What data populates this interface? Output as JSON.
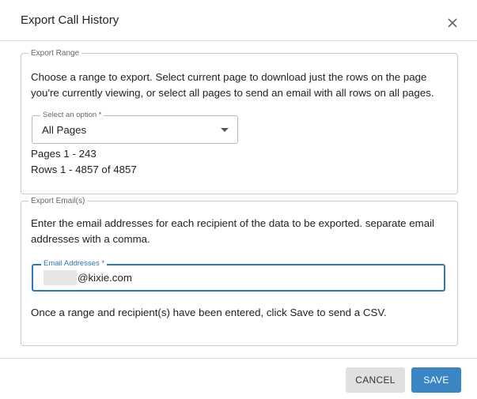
{
  "dialog": {
    "title": "Export Call History"
  },
  "export_range": {
    "legend": "Export Range",
    "description": "Choose a range to export. Select current page to download just the rows on the page you're currently viewing, or select all pages to send an email with all rows on all pages.",
    "select": {
      "label": "Select an option *",
      "value": "All Pages"
    },
    "pages_text": "Pages 1 - 243",
    "rows_text": "Rows 1 - 4857 of 4857"
  },
  "export_emails": {
    "legend": "Export Email(s)",
    "description": "Enter the email addresses for each recipient of the data to be exported. separate email addresses with a comma.",
    "email_field": {
      "label": "Email Addresses *",
      "value": "@kixie.com"
    },
    "note": "Once a range and recipient(s) have been entered, click Save to send a CSV."
  },
  "footer": {
    "cancel_label": "CANCEL",
    "save_label": "SAVE"
  },
  "colors": {
    "accent": "#3a85c3",
    "focus_border": "#2e78b7"
  },
  "icons": {
    "close": "close-icon",
    "dropdown": "chevron-down-icon"
  }
}
